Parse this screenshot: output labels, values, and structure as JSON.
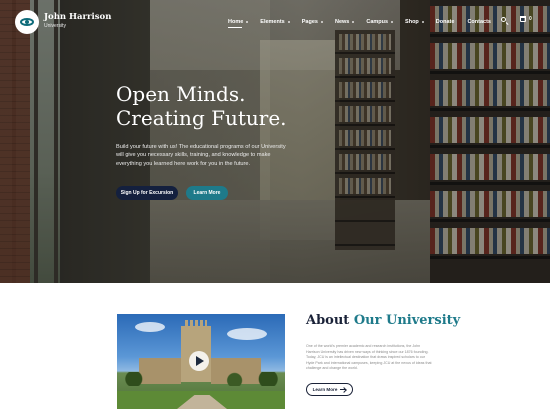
{
  "brand": {
    "title": "John Harrison",
    "subtitle": "University",
    "logo_icon": "eye-logo-icon",
    "accent_color": "#1e7a8a",
    "dark_color": "#14203e"
  },
  "nav": {
    "items": [
      {
        "label": "Home",
        "active": true,
        "has_dropdown": true
      },
      {
        "label": "Elements",
        "active": false,
        "has_dropdown": true
      },
      {
        "label": "Pages",
        "active": false,
        "has_dropdown": true
      },
      {
        "label": "News",
        "active": false,
        "has_dropdown": true
      },
      {
        "label": "Campus",
        "active": false,
        "has_dropdown": true
      },
      {
        "label": "Shop",
        "active": false,
        "has_dropdown": true
      },
      {
        "label": "Donate",
        "active": false,
        "has_dropdown": false
      },
      {
        "label": "Contacts",
        "active": false,
        "has_dropdown": false
      }
    ],
    "search_icon": "search-icon",
    "cart_icon": "cart-icon",
    "cart_count": "0"
  },
  "hero": {
    "title_line1": "Open Minds.",
    "title_line2": "Creating Future.",
    "description": "Build your future with us! The educational programs of our University will give you necessary skills, training, and knowledge to make everything you learned here work for you in the future.",
    "primary_button": "Sign Up for Excursion",
    "secondary_button": "Learn More"
  },
  "about": {
    "title_plain": "About",
    "title_accent": "Our University",
    "text": "One of the world's premier academic and research institutions, the John Harrison University has driven new ways of thinking since our 1876 founding. Today, JCU is an intellectual destination that draws inspired scholars to our Hyde Park and international campuses, keeping JCU at the nexus of ideas that challenge and change the world.",
    "button": "Learn More",
    "play_icon": "play-icon"
  }
}
